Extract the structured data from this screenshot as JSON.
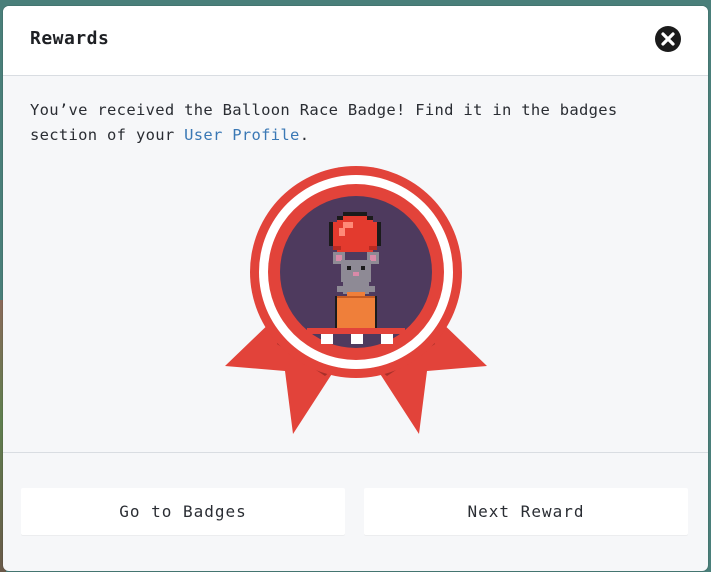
{
  "header": {
    "title": "Rewards",
    "close_icon": "close-icon"
  },
  "message": {
    "text_before": "You’ve received the Balloon Race Badge! Find it in the badges section of your ",
    "link_text": "User Profile",
    "text_after": "."
  },
  "badge": {
    "icon": "balloon-race-badge",
    "colors": {
      "ribbon": "#e2433a",
      "ring": "#e2433a",
      "inner_bg": "#4e3a5e",
      "balloon": "#e33a2e",
      "mouse": "#8e8a95",
      "box": "#ef7f3a"
    }
  },
  "buttons": {
    "go_to_badges": "Go to Badges",
    "next_reward": "Next Reward"
  },
  "colors": {
    "link": "#3a78b5",
    "dialog_bg": "#f6f7f9",
    "header_bg": "#ffffff"
  }
}
